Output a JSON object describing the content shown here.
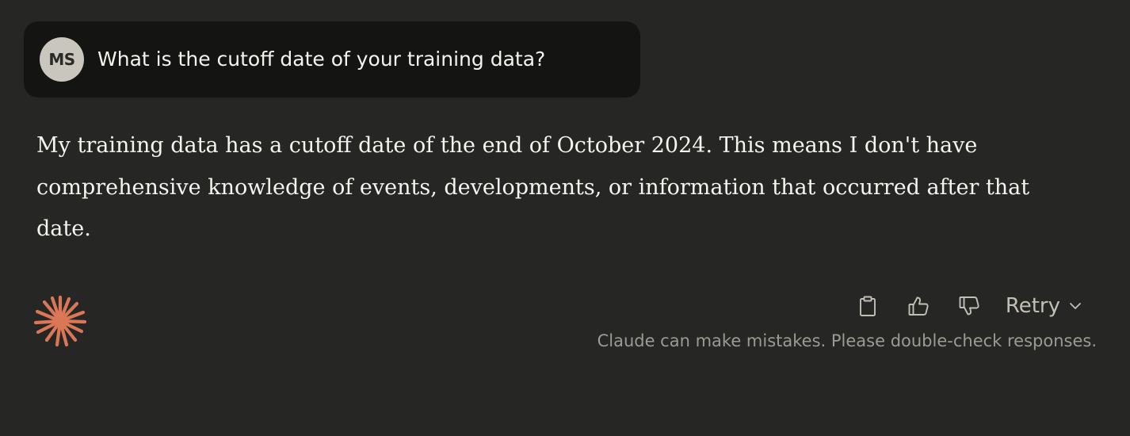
{
  "user_message": {
    "avatar_initials": "MS",
    "text": "What is the cutoff date of your training data?"
  },
  "assistant_message": {
    "text": "My training data has a cutoff date of the end of October 2024. This means I don't have comprehensive knowledge of events, developments, or information that occurred after that date."
  },
  "actions": {
    "copy_icon": "clipboard-icon",
    "thumbs_up_icon": "thumbs-up-icon",
    "thumbs_down_icon": "thumbs-down-icon",
    "retry_label": "Retry",
    "retry_icon": "chevron-down-icon"
  },
  "footer": {
    "disclaimer": "Claude can make mistakes. Please double-check responses."
  },
  "colors": {
    "background": "#262624",
    "user_bubble": "#141413",
    "avatar": "#c9c7bd",
    "claude_logo": "#d97757",
    "text": "#f5f4ee",
    "muted_text": "#9c9a92"
  }
}
